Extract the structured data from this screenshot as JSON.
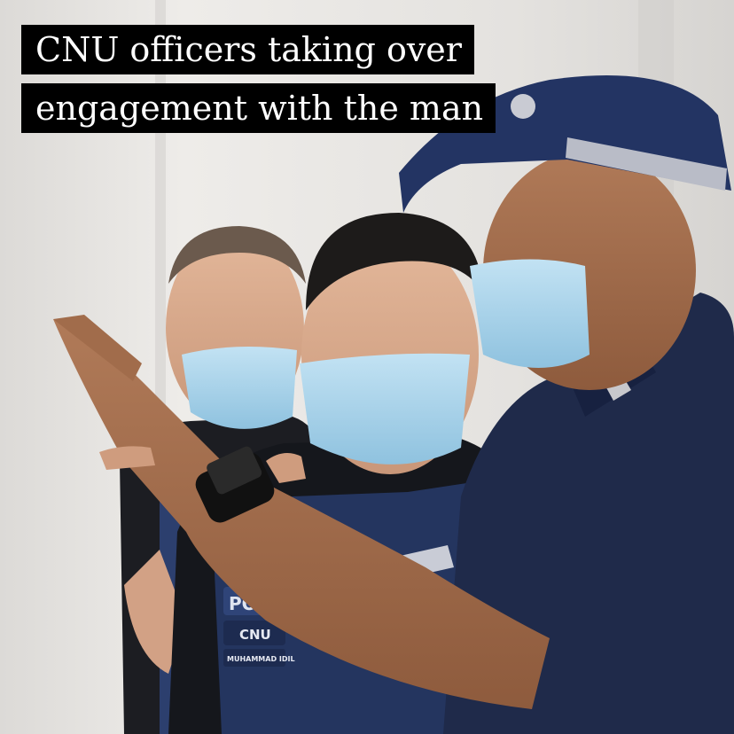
{
  "caption": {
    "line1": "CNU officers taking over",
    "line2": "engagement with the man"
  },
  "vest": {
    "police_label": "POLI",
    "unit_label": "CNU",
    "name_tag": "MUHAMMAD IDIL"
  },
  "colors": {
    "uniform_navy": "#1f2a4a",
    "cap_navy": "#233463",
    "mask_blue": "#a9d3ea",
    "wall": "#e9e7e4",
    "caption_bg": "#000000",
    "caption_text": "#ffffff"
  }
}
